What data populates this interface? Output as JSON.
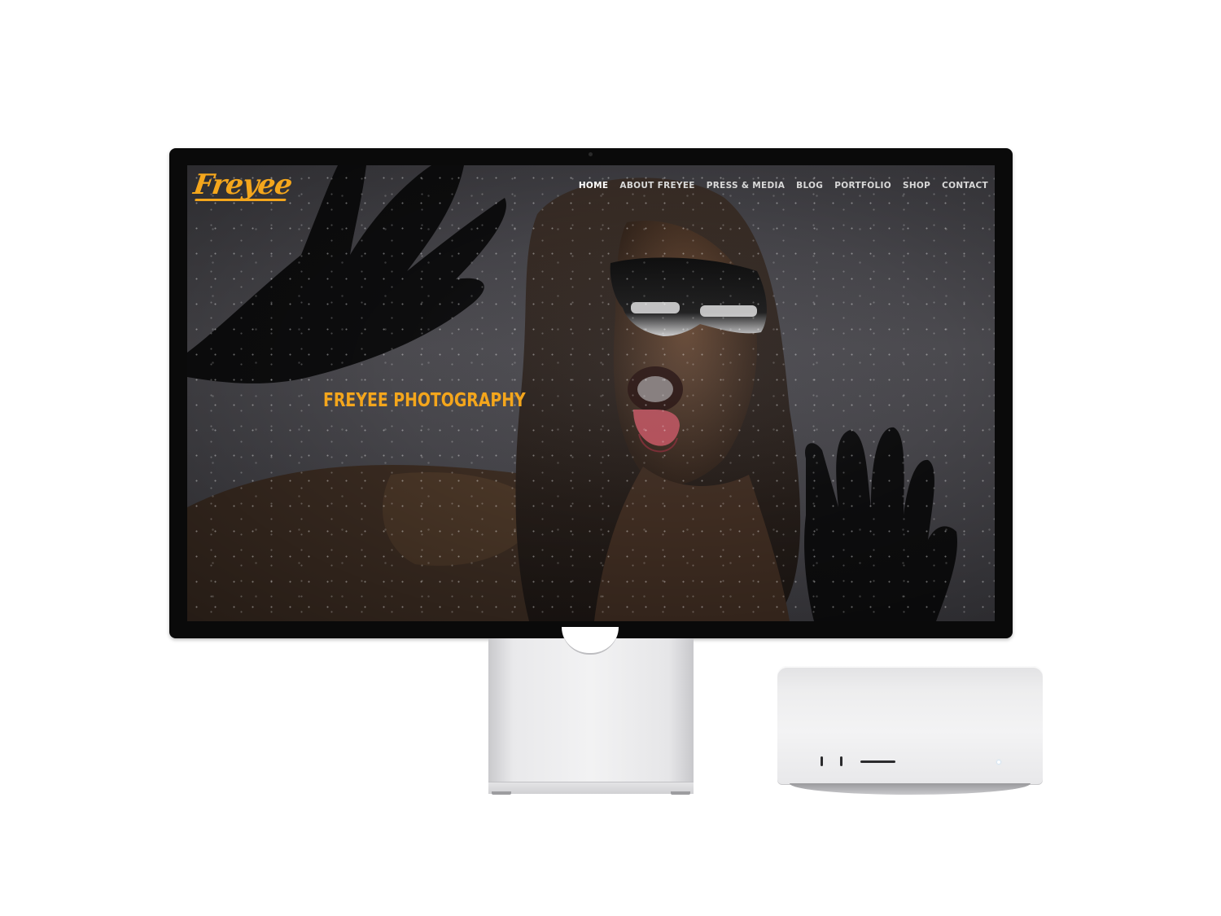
{
  "site": {
    "logo_text": "Freyee",
    "brand_color": "#f4a61c",
    "nav": [
      {
        "label": "HOME",
        "active": true
      },
      {
        "label": "ABOUT FREYEE",
        "active": false
      },
      {
        "label": "PRESS & MEDIA",
        "active": false
      },
      {
        "label": "BLOG",
        "active": false
      },
      {
        "label": "PORTFOLIO",
        "active": false
      },
      {
        "label": "SHOP",
        "active": false
      },
      {
        "label": "CONTACT",
        "active": false
      }
    ],
    "hero_title": "FREYEE PHOTOGRAPHY",
    "hero_image": "photo-woman-sunglasses-behind-wet-glass"
  },
  "devices": {
    "monitor": "studio-display",
    "computer": "mac-studio"
  }
}
